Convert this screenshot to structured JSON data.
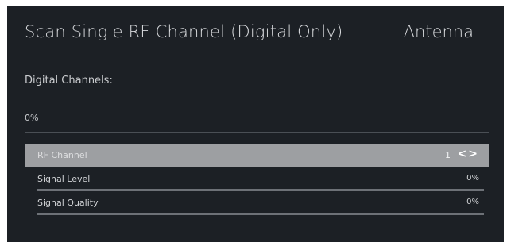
{
  "header": {
    "title": "Scan Single RF Channel (Digital Only)",
    "source": "Antenna"
  },
  "scan": {
    "digital_channels_label": "Digital Channels:",
    "progress_text": "0%",
    "progress_fraction": 0.0
  },
  "rows": [
    {
      "label": "RF Channel",
      "value": "1",
      "arrows": "<>",
      "selected": true
    },
    {
      "label": "Signal Level",
      "value": "0%",
      "level_fraction": 0.0
    },
    {
      "label": "Signal Quality",
      "value": "0%",
      "level_fraction": 0.0
    }
  ],
  "colors": {
    "background": "#1c2025",
    "selected_row": "#9d9fa2",
    "text": "#d4d6d9"
  }
}
